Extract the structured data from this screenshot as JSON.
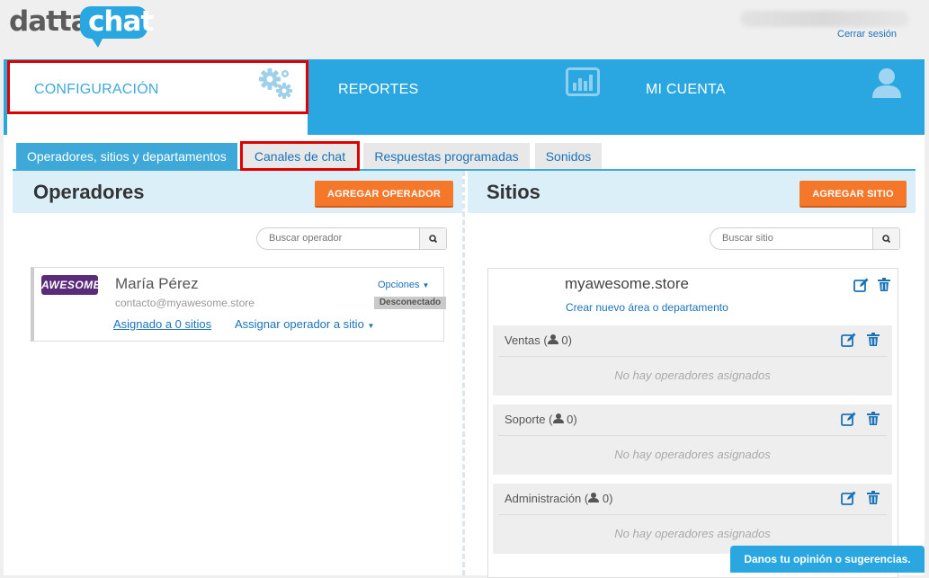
{
  "brand": {
    "part1": "datta",
    "part2": "chat"
  },
  "header": {
    "logout_label": "Cerrar sesión"
  },
  "main_tabs": [
    {
      "label": "CONFIGURACIÓN",
      "icon": "gears-icon",
      "active": true
    },
    {
      "label": "REPORTES",
      "icon": "bar-chart-icon",
      "active": false
    },
    {
      "label": "MI CUENTA",
      "icon": "user-icon",
      "active": false
    }
  ],
  "sub_tabs": [
    {
      "label": "Operadores, sitios y departamentos",
      "active": true
    },
    {
      "label": "Canales de chat",
      "active": false
    },
    {
      "label": "Respuestas programadas",
      "active": false
    },
    {
      "label": "Sonidos",
      "active": false
    }
  ],
  "operators": {
    "title": "Operadores",
    "add_button": "AGREGAR OPERADOR",
    "search_placeholder": "Buscar operador",
    "items": [
      {
        "avatar_text": "AWESOME",
        "name": "María Pérez",
        "email": "contacto@myawesome.store",
        "options_label": "Opciones",
        "status": "Desconectado",
        "assigned_label": "Asignado a 0 sitios",
        "assign_label": "Assignar operador a sitio"
      }
    ]
  },
  "sites": {
    "title": "Sitios",
    "add_button": "AGREGAR SITIO",
    "search_placeholder": "Buscar sitio",
    "items": [
      {
        "name": "myawesome.store",
        "create_label": "Crear nuevo área o departamento",
        "departments": [
          {
            "name": "Ventas",
            "count": "0",
            "empty": "No hay operadores asignados"
          },
          {
            "name": "Soporte",
            "count": "0",
            "empty": "No hay operadores asignados"
          },
          {
            "name": "Administración",
            "count": "0",
            "empty": "No hay operadores asignados"
          }
        ]
      }
    ]
  },
  "feedback": {
    "label": "Danos tu opinión o sugerencias."
  },
  "colors": {
    "brand_blue": "#2aa7e0",
    "accent_orange": "#f4772a",
    "link_blue": "#1a73b8",
    "highlight_red": "#e00000"
  }
}
